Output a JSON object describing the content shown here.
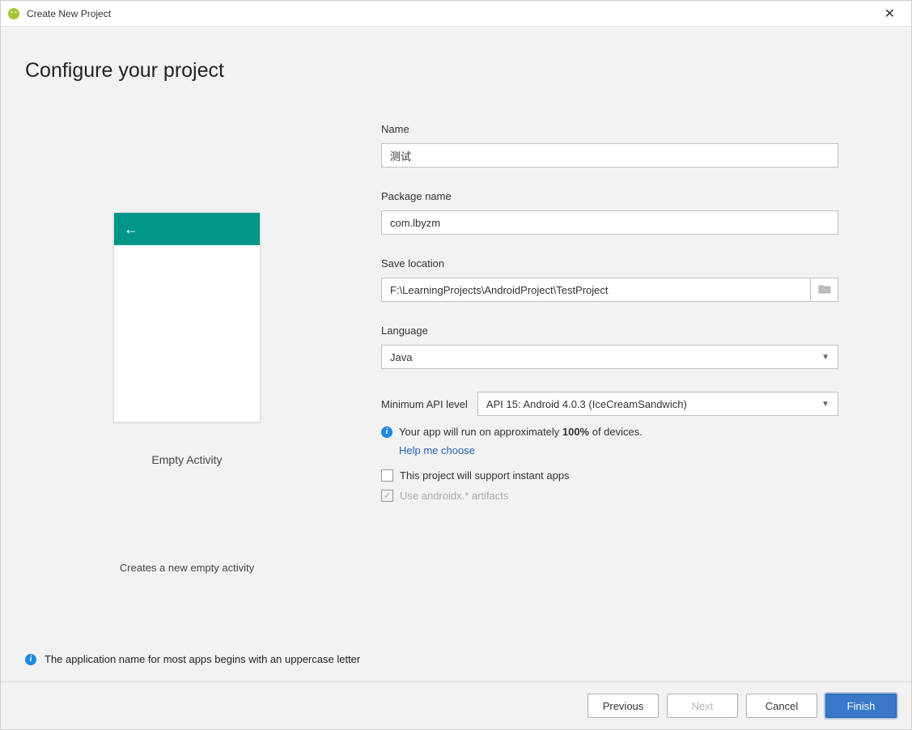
{
  "titlebar": {
    "title": "Create New Project"
  },
  "page": {
    "heading": "Configure your project"
  },
  "preview": {
    "label": "Empty Activity",
    "description": "Creates a new empty activity"
  },
  "form": {
    "name": {
      "label": "Name",
      "value": "测试"
    },
    "package": {
      "label": "Package name",
      "value": "com.lbyzm"
    },
    "location": {
      "label": "Save location",
      "value": "F:\\LearningProjects\\AndroidProject\\TestProject"
    },
    "language": {
      "label": "Language",
      "value": "Java"
    },
    "api": {
      "label": "Minimum API level",
      "value": "API 15: Android 4.0.3 (IceCreamSandwich)"
    },
    "coverage_prefix": "Your app will run on approximately ",
    "coverage_pct": "100%",
    "coverage_suffix": " of devices.",
    "help_link": "Help me choose",
    "instant_apps": "This project will support instant apps",
    "androidx": "Use androidx.* artifacts"
  },
  "footer": {
    "warning": "The application name for most apps begins with an uppercase letter"
  },
  "buttons": {
    "previous": "Previous",
    "next": "Next",
    "cancel": "Cancel",
    "finish": "Finish"
  }
}
